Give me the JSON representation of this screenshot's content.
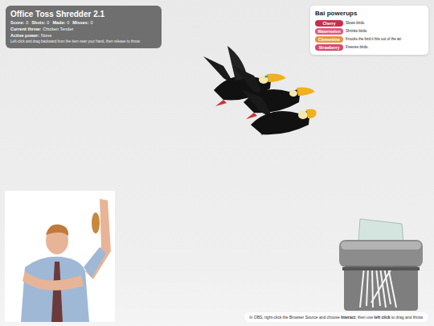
{
  "hud": {
    "title": "Office Toss Shredder 2.1",
    "stats": [
      {
        "label": "Score:",
        "value": "0"
      },
      {
        "label": "Shots:",
        "value": "0"
      },
      {
        "label": "Made:",
        "value": "0"
      },
      {
        "label": "Misses:",
        "value": "0"
      }
    ],
    "current_throw": {
      "label": "Current throw:",
      "value": "Chicken Tender"
    },
    "active_power": {
      "label": "Active power:",
      "value": "None"
    },
    "hint": "Left-click and drag backward from the item near your hand, then release to throw."
  },
  "powerups": {
    "title": "Bai powerups",
    "items": [
      {
        "name": "Cherry",
        "description": "Slows birds.",
        "color": "#c7304b"
      },
      {
        "name": "Watermelon",
        "description": "Shrinks birds.",
        "color": "#e0567e"
      },
      {
        "name": "Clementine",
        "description": "Knocks the bird it hits out of the air.",
        "color": "#e8943a"
      },
      {
        "name": "Strawberry",
        "description": "Freezes birds.",
        "color": "#d9486a"
      }
    ]
  },
  "footer": {
    "parts": [
      {
        "text": "In OBS, right-click the Browser Source and choose ",
        "bold": false
      },
      {
        "text": "Interact",
        "bold": true
      },
      {
        "text": ", then use ",
        "bold": false
      },
      {
        "text": "left click",
        "bold": true
      },
      {
        "text": " to drag and throw.",
        "bold": false
      }
    ]
  }
}
